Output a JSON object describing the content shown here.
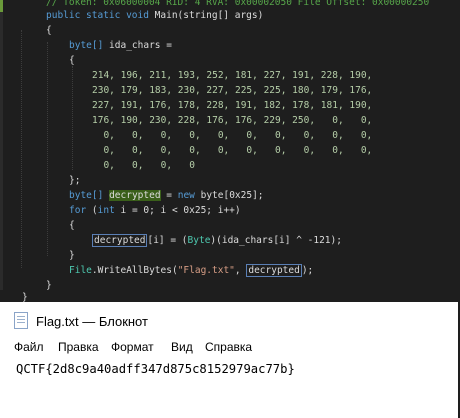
{
  "code": {
    "comment": "// Token: 0x06000004 RID: 4 RVA: 0x00002050 File Offset: 0x00000250",
    "signature_kw": "public static void",
    "signature_rest": " Main(string[] args)",
    "brace": "{",
    "close_brace": "}",
    "close_array": "};",
    "decl_type": "byte[]",
    "decl_name": " ida_chars =",
    "array_rows": [
      "214, 196, 211, 193, 252, 181, 227, 191, 228, 190,",
      "230, 179, 183, 230, 227, 225, 225, 180, 179, 176,",
      "227, 191, 176, 178, 228, 191, 182, 178, 181, 190,",
      "176, 190, 230, 228, 176, 176, 229, 250,   0,   0,",
      "  0,   0,   0,   0,   0,   0,   0,   0,   0,   0,",
      "  0,   0,   0,   0,   0,   0,   0,   0,   0,   0,",
      "  0,   0,   0,   0"
    ],
    "decrypted_var": "decrypted",
    "new_kw": "new",
    "new_expr": " byte[0x25];",
    "for_kw": "for",
    "for_open": " (",
    "int_kw": "int",
    "for_rest": " i = 0; i < 0x25; i++)",
    "assign_rest": "[i] = (",
    "cast_type": "Byte",
    "assign_tail": ")(ida_chars[i] ^ -121);",
    "file_class": "File",
    "write_call": ".WriteAllBytes(",
    "filename": "\"Flag.txt\"",
    "comma": ", ",
    "call_end": ");"
  },
  "notepad": {
    "title": "Flag.txt — Блокнот",
    "menu": [
      "Файл",
      "Правка",
      "Формат",
      "Вид",
      "Справка"
    ],
    "content": "QCTF{2d8c9a40adff347d875c8152979ac77b}"
  }
}
